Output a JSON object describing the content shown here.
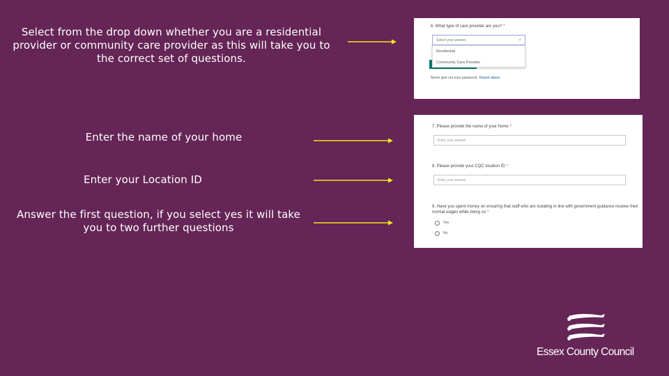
{
  "instructions": [
    "Select from the drop down whether you are a residential provider or community care provider as this will take you to the correct set of questions.",
    "Enter the name of your home",
    "Enter your Location ID",
    "Answer the first question, if you select yes it will take you to two further questions"
  ],
  "colors": {
    "background": "#652556",
    "arrow": "#f5e81a",
    "accent_green": "#0b7d70"
  },
  "form1": {
    "question": "6. What type of care provider are you?",
    "required_mark": "*",
    "dropdown_value": "Select your answer",
    "options": [
      "Residential",
      "Community Care Provider"
    ],
    "footer_text": "Never give out your password.",
    "footer_link": "Report abuse"
  },
  "form2": {
    "q7": "7. Please provide the name of your home",
    "q7_placeholder": "Enter your answer",
    "q8": "8. Please provide your CQC location ID",
    "q8_placeholder": "Enter your answer",
    "q9": "9. Have you spent money on ensuring that staff who are isolating in line with government guidance receive their normal wages while doing so",
    "required_mark": "*",
    "radio_options": [
      "Yes",
      "No"
    ]
  },
  "logo": {
    "name": "Essex County Council",
    "icon": "three-seaxes-crest-icon"
  }
}
